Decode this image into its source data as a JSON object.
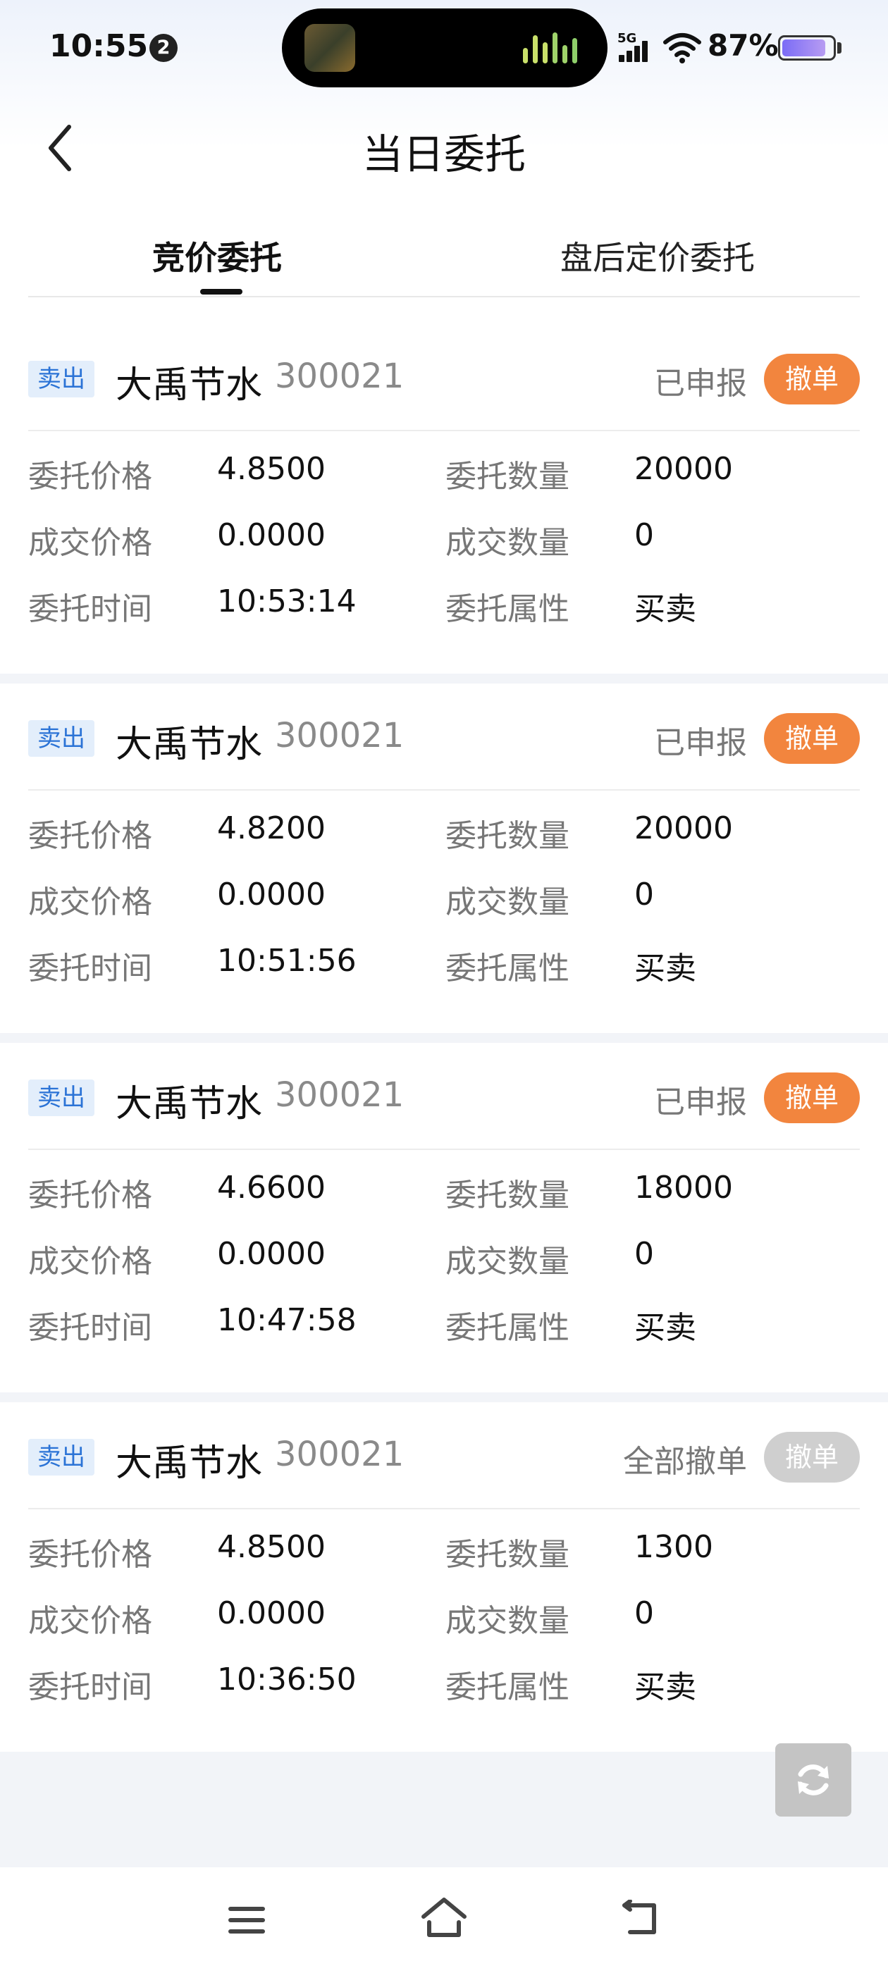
{
  "status_bar": {
    "time": "10:55",
    "notification_count": "2",
    "network": "5G",
    "battery": "87%",
    "battery_level": 0.87
  },
  "header": {
    "title": "当日委托",
    "back_icon": "chevron-left-icon"
  },
  "tabs": [
    {
      "label": "竞价委托",
      "active": true
    },
    {
      "label": "盘后定价委托",
      "active": false
    }
  ],
  "labels": {
    "price": "委托价格",
    "quantity": "委托数量",
    "deal_price": "成交价格",
    "deal_quantity": "成交数量",
    "time": "委托时间",
    "attribute": "委托属性",
    "cancel": "撤单"
  },
  "orders": [
    {
      "side": "卖出",
      "name": "大禹节水",
      "code": "300021",
      "status": "已申报",
      "cancellable": true,
      "price": "4.8500",
      "quantity": "20000",
      "deal_price": "0.0000",
      "deal_quantity": "0",
      "time": "10:53:14",
      "attribute": "买卖"
    },
    {
      "side": "卖出",
      "name": "大禹节水",
      "code": "300021",
      "status": "已申报",
      "cancellable": true,
      "price": "4.8200",
      "quantity": "20000",
      "deal_price": "0.0000",
      "deal_quantity": "0",
      "time": "10:51:56",
      "attribute": "买卖"
    },
    {
      "side": "卖出",
      "name": "大禹节水",
      "code": "300021",
      "status": "已申报",
      "cancellable": true,
      "price": "4.6600",
      "quantity": "18000",
      "deal_price": "0.0000",
      "deal_quantity": "0",
      "time": "10:47:58",
      "attribute": "买卖"
    },
    {
      "side": "卖出",
      "name": "大禹节水",
      "code": "300021",
      "status": "全部撤单",
      "cancellable": false,
      "price": "4.8500",
      "quantity": "1300",
      "deal_price": "0.0000",
      "deal_quantity": "0",
      "time": "10:36:50",
      "attribute": "买卖"
    }
  ],
  "colors": {
    "accent_orange": "#f2853e",
    "sell_tag_text": "#2b73d6",
    "sell_tag_bg": "#e3eefb",
    "disabled": "#cfcfcf"
  },
  "icons": {
    "refresh": "refresh-icon",
    "nav_menu": "menu-icon",
    "nav_home": "home-icon",
    "nav_back": "back-icon"
  }
}
